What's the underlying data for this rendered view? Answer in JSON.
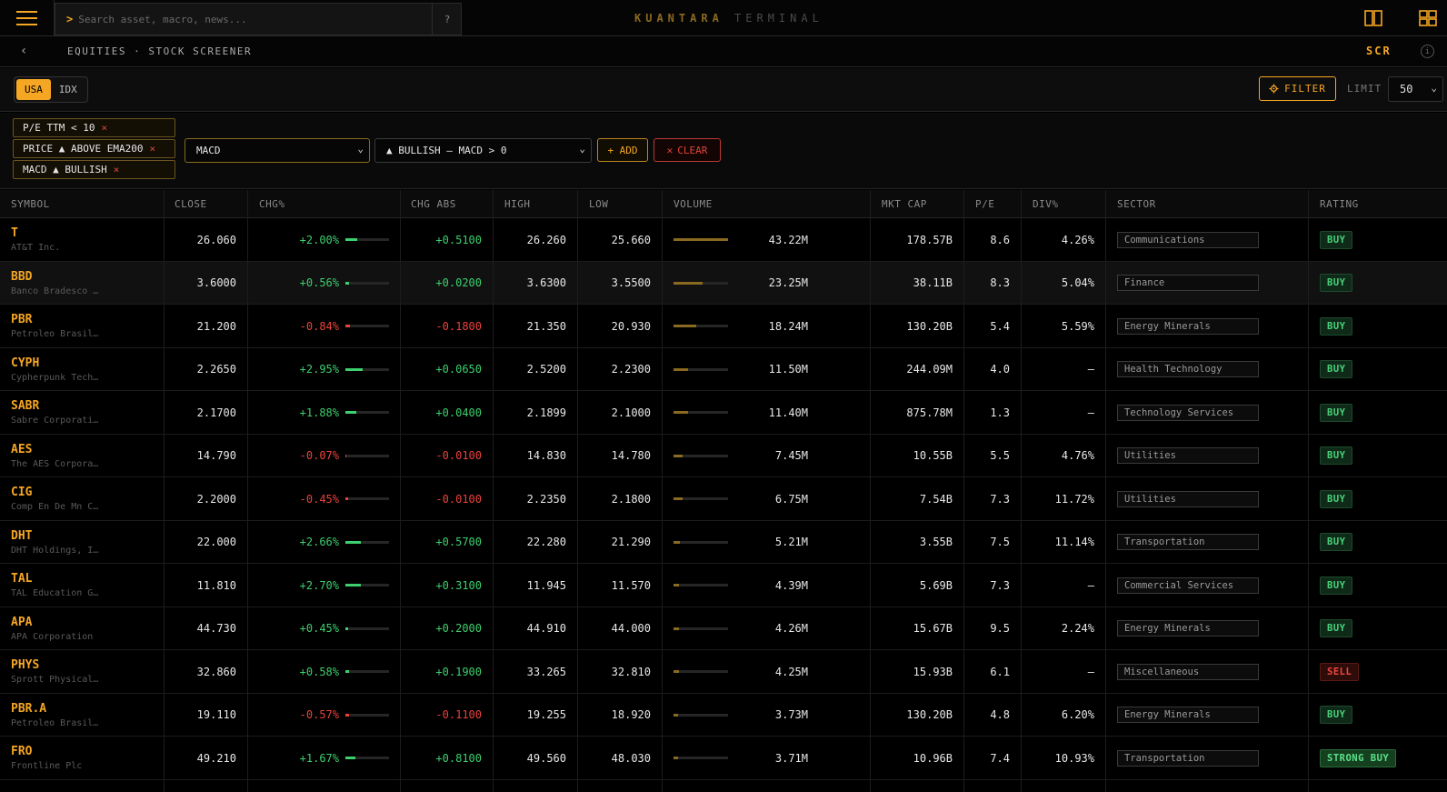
{
  "search": {
    "placeholder": "Search asset, macro, news...",
    "help": "?"
  },
  "brand": {
    "part1": "KUANTARA",
    "part2": "TERMINAL"
  },
  "breadcrumb": {
    "text": "EQUITIES · STOCK SCREENER",
    "code": "SCR"
  },
  "market": {
    "options": [
      "USA",
      "IDX"
    ],
    "selected": "USA"
  },
  "filter_button": "FILTER",
  "limit": {
    "label": "LIMIT",
    "value": "50"
  },
  "active_filters": [
    {
      "label": "P/E TTM < 10"
    },
    {
      "label": "PRICE ▲ ABOVE EMA200"
    },
    {
      "label": "MACD ▲ BULLISH"
    }
  ],
  "filter_builder": {
    "indicator": "MACD",
    "condition": "▲ BULLISH — MACD > 0",
    "add": "+ ADD",
    "clear": "CLEAR"
  },
  "columns": [
    "SYMBOL",
    "CLOSE",
    "CHG%",
    "CHG ABS",
    "HIGH",
    "LOW",
    "VOLUME",
    "MKT CAP",
    "P/E",
    "DIV%",
    "SECTOR",
    "RATING"
  ],
  "rows": [
    {
      "symbol": "T",
      "name": "AT&T Inc.",
      "close": "26.060",
      "chg_pct": "+2.00%",
      "chg_fill": 0.27,
      "chg_abs": "+0.5100",
      "high": "26.260",
      "low": "25.660",
      "volume": "43.22M",
      "vol_fill": 1.0,
      "mkt_cap": "178.57B",
      "pe": "8.6",
      "div": "4.26%",
      "sector": "Communications",
      "rating": "BUY",
      "up": true
    },
    {
      "symbol": "BBD",
      "name": "Banco Bradesco …",
      "close": "3.6000",
      "chg_pct": "+0.56%",
      "chg_fill": 0.08,
      "chg_abs": "+0.0200",
      "high": "3.6300",
      "low": "3.5500",
      "volume": "23.25M",
      "vol_fill": 0.54,
      "mkt_cap": "38.11B",
      "pe": "8.3",
      "div": "5.04%",
      "sector": "Finance",
      "rating": "BUY",
      "up": true
    },
    {
      "symbol": "PBR",
      "name": "Petroleo Brasil…",
      "close": "21.200",
      "chg_pct": "-0.84%",
      "chg_fill": 0.11,
      "chg_abs": "-0.1800",
      "high": "21.350",
      "low": "20.930",
      "volume": "18.24M",
      "vol_fill": 0.42,
      "mkt_cap": "130.20B",
      "pe": "5.4",
      "div": "5.59%",
      "sector": "Energy Minerals",
      "rating": "BUY",
      "up": false
    },
    {
      "symbol": "CYPH",
      "name": "Cypherpunk Tech…",
      "close": "2.2650",
      "chg_pct": "+2.95%",
      "chg_fill": 0.4,
      "chg_abs": "+0.0650",
      "high": "2.5200",
      "low": "2.2300",
      "volume": "11.50M",
      "vol_fill": 0.27,
      "mkt_cap": "244.09M",
      "pe": "4.0",
      "div": "—",
      "sector": "Health Technology",
      "rating": "BUY",
      "up": true
    },
    {
      "symbol": "SABR",
      "name": "Sabre Corporati…",
      "close": "2.1700",
      "chg_pct": "+1.88%",
      "chg_fill": 0.25,
      "chg_abs": "+0.0400",
      "high": "2.1899",
      "low": "2.1000",
      "volume": "11.40M",
      "vol_fill": 0.26,
      "mkt_cap": "875.78M",
      "pe": "1.3",
      "div": "—",
      "sector": "Technology Services",
      "rating": "BUY",
      "up": true
    },
    {
      "symbol": "AES",
      "name": "The AES Corpora…",
      "close": "14.790",
      "chg_pct": "-0.07%",
      "chg_fill": 0.02,
      "chg_abs": "-0.0100",
      "high": "14.830",
      "low": "14.780",
      "volume": "7.45M",
      "vol_fill": 0.17,
      "mkt_cap": "10.55B",
      "pe": "5.5",
      "div": "4.76%",
      "sector": "Utilities",
      "rating": "BUY",
      "up": false
    },
    {
      "symbol": "CIG",
      "name": "Comp En De Mn C…",
      "close": "2.2000",
      "chg_pct": "-0.45%",
      "chg_fill": 0.06,
      "chg_abs": "-0.0100",
      "high": "2.2350",
      "low": "2.1800",
      "volume": "6.75M",
      "vol_fill": 0.16,
      "mkt_cap": "7.54B",
      "pe": "7.3",
      "div": "11.72%",
      "sector": "Utilities",
      "rating": "BUY",
      "up": false
    },
    {
      "symbol": "DHT",
      "name": "DHT Holdings, I…",
      "close": "22.000",
      "chg_pct": "+2.66%",
      "chg_fill": 0.36,
      "chg_abs": "+0.5700",
      "high": "22.280",
      "low": "21.290",
      "volume": "5.21M",
      "vol_fill": 0.12,
      "mkt_cap": "3.55B",
      "pe": "7.5",
      "div": "11.14%",
      "sector": "Transportation",
      "rating": "BUY",
      "up": true
    },
    {
      "symbol": "TAL",
      "name": "TAL Education G…",
      "close": "11.810",
      "chg_pct": "+2.70%",
      "chg_fill": 0.36,
      "chg_abs": "+0.3100",
      "high": "11.945",
      "low": "11.570",
      "volume": "4.39M",
      "vol_fill": 0.1,
      "mkt_cap": "5.69B",
      "pe": "7.3",
      "div": "—",
      "sector": "Commercial Services",
      "rating": "BUY",
      "up": true
    },
    {
      "symbol": "APA",
      "name": "APA Corporation",
      "close": "44.730",
      "chg_pct": "+0.45%",
      "chg_fill": 0.06,
      "chg_abs": "+0.2000",
      "high": "44.910",
      "low": "44.000",
      "volume": "4.26M",
      "vol_fill": 0.1,
      "mkt_cap": "15.67B",
      "pe": "9.5",
      "div": "2.24%",
      "sector": "Energy Minerals",
      "rating": "BUY",
      "up": true
    },
    {
      "symbol": "PHYS",
      "name": "Sprott Physical…",
      "close": "32.860",
      "chg_pct": "+0.58%",
      "chg_fill": 0.08,
      "chg_abs": "+0.1900",
      "high": "33.265",
      "low": "32.810",
      "volume": "4.25M",
      "vol_fill": 0.1,
      "mkt_cap": "15.93B",
      "pe": "6.1",
      "div": "—",
      "sector": "Miscellaneous",
      "rating": "SELL",
      "up": true
    },
    {
      "symbol": "PBR.A",
      "name": "Petroleo Brasil…",
      "close": "19.110",
      "chg_pct": "-0.57%",
      "chg_fill": 0.08,
      "chg_abs": "-0.1100",
      "high": "19.255",
      "low": "18.920",
      "volume": "3.73M",
      "vol_fill": 0.09,
      "mkt_cap": "130.20B",
      "pe": "4.8",
      "div": "6.20%",
      "sector": "Energy Minerals",
      "rating": "BUY",
      "up": false
    },
    {
      "symbol": "FRO",
      "name": "Frontline Plc",
      "close": "49.210",
      "chg_pct": "+1.67%",
      "chg_fill": 0.22,
      "chg_abs": "+0.8100",
      "high": "49.560",
      "low": "48.030",
      "volume": "3.71M",
      "vol_fill": 0.09,
      "mkt_cap": "10.96B",
      "pe": "7.4",
      "div": "10.93%",
      "sector": "Transportation",
      "rating": "STRONG BUY",
      "up": true
    }
  ],
  "colors": {
    "accent": "#f5a623",
    "up": "#3ecf6e",
    "down": "#e8433b"
  }
}
